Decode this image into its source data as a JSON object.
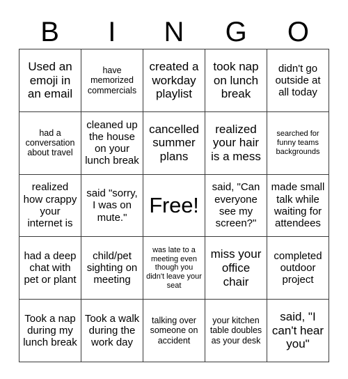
{
  "card": {
    "title": "BINGO",
    "header_letters": [
      "B",
      "I",
      "N",
      "G",
      "O"
    ],
    "free_space_label": "Free!",
    "rows": [
      [
        "Used an emoji in an email",
        "have memorized commercials",
        "created a workday playlist",
        "took nap on lunch break",
        "didn't go outside at all today"
      ],
      [
        "had a conversation about travel",
        "cleaned up the house on your lunch break",
        "cancelled summer plans",
        "realized your hair is a mess",
        "searched for funny teams backgrounds"
      ],
      [
        "realized how crappy your internet is",
        "said \"sorry, I was on mute.\"",
        "Free!",
        "said, \"Can everyone see my screen?\"",
        "made small talk while waiting for attendees"
      ],
      [
        "had a deep chat with pet or plant",
        "child/pet sighting on meeting",
        "was late to a meeting even though you didn't leave your seat",
        "miss your office chair",
        "completed outdoor project"
      ],
      [
        "Took a nap during my lunch break",
        "Took a walk during the work day",
        "talking over someone on accident",
        "your kitchen table doubles as your desk",
        "said, \"I can't hear you\""
      ]
    ]
  },
  "colors": {
    "background": "#ffffff",
    "text": "#000000",
    "grid_line": "#3a3a3a"
  }
}
